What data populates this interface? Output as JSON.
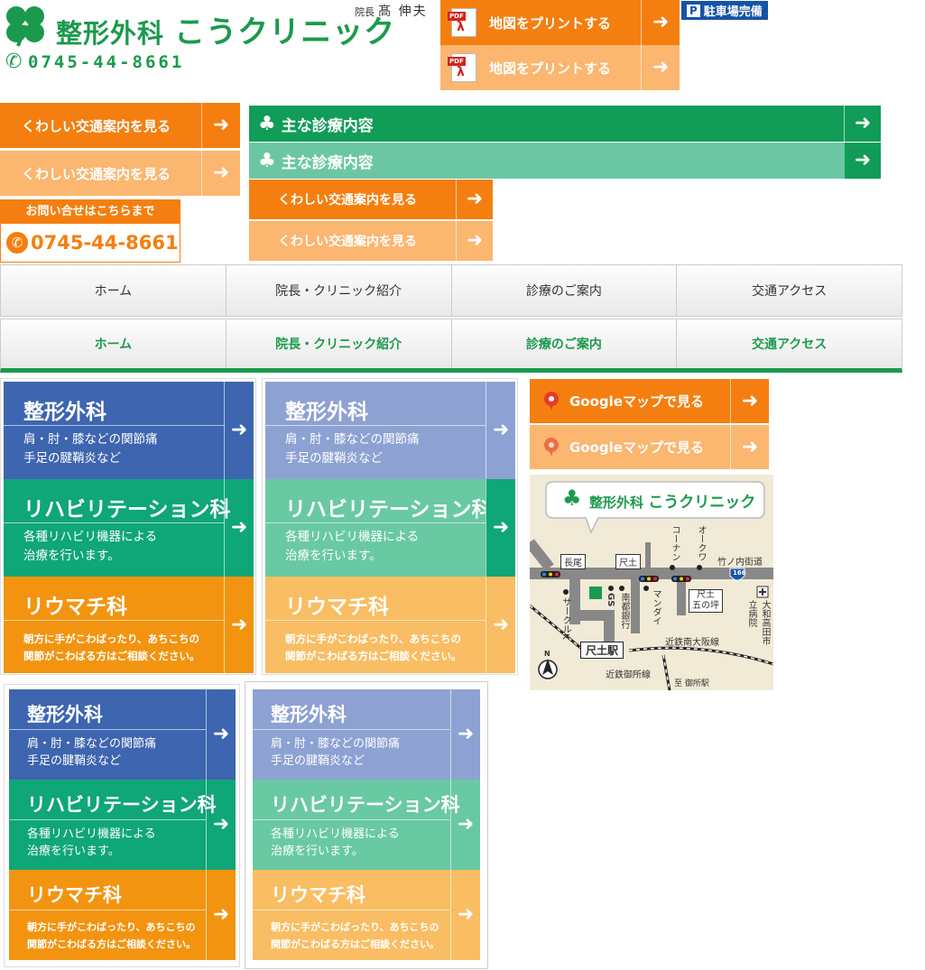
{
  "header": {
    "logo_main": "整形外科",
    "logo_sub": "こうクリニック",
    "director_label": "院長",
    "director_name": "髙 伸夫",
    "phone": "0745-44-8661",
    "parking_p": "P",
    "parking": "駐車場完備",
    "print_map": "地図をプリントする",
    "pdf_tag": "PDF"
  },
  "buttons": {
    "access": "くわしい交通案内を見る",
    "services": "主な診療内容",
    "contact_label": "お問い合せはこちらまで",
    "contact_phone": "0745-44-8661",
    "google_map": "Googleマップで見る"
  },
  "nav": {
    "items": [
      "ホーム",
      "院長・クリニック紹介",
      "診療のご案内",
      "交通アクセス"
    ]
  },
  "depts": [
    {
      "title": "整形外科",
      "line1": "肩・肘・膝などの関節痛",
      "line2": "手足の腱鞘炎など"
    },
    {
      "title": "リハビリテーション科",
      "line1": "各種リハビリ機器による",
      "line2": "治療を行います。"
    },
    {
      "title": "リウマチ科",
      "line1": "朝方に手がこわばったり、あちこちの",
      "line2": "関節がこわばる方はご相談ください。"
    }
  ],
  "colors": {
    "green": "#1b9a4d",
    "orange": "#f47f10",
    "orange_light": "#fbb670",
    "blue": "#3d65b0",
    "blue_light": "#8da2d2",
    "teal": "#0fa678",
    "teal_light": "#69c9a3",
    "amber": "#f39410",
    "amber_light": "#f9bd63"
  },
  "mini_map": {
    "logo_main": "整形外科",
    "logo_sub": "こうクリニック",
    "street": "竹ノ内街道",
    "route": "166",
    "station": "尺土駅",
    "rail1": "近鉄南大阪線",
    "rail2": "近鉄御所線",
    "toward": "至 御所駅",
    "nagao": "長尾",
    "shakudo": "尺土",
    "shakudo5": "尺土",
    "gotsubo": "五の坪",
    "konan": "コーナン",
    "okuwa": "オークワ",
    "gs": "GS",
    "nanto": "南都銀行",
    "mandai": "マンダイ",
    "circlek": "サークルK",
    "hospital": "大和高田市立病院",
    "north": "N"
  }
}
